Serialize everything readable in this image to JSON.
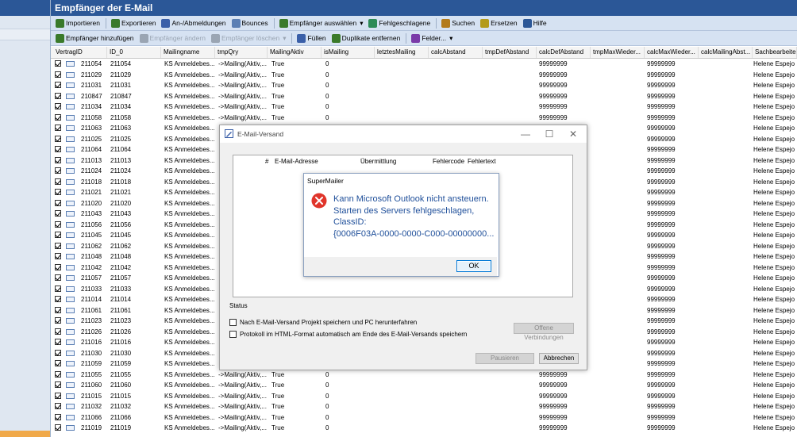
{
  "window": {
    "title": "Empfänger der E-Mail"
  },
  "toolbar1": [
    {
      "label": "Importieren",
      "icon": "import-icon",
      "color": "#3a7a2a"
    },
    {
      "label": "Exportieren",
      "icon": "export-icon",
      "color": "#3a7a2a"
    },
    {
      "label": "An-/Abmeldungen",
      "icon": "users-icon",
      "color": "#3a5fa8"
    },
    {
      "label": "Bounces",
      "icon": "bounce-icon",
      "color": "#5b7fb4"
    },
    {
      "label": "Empfänger auswählen",
      "icon": "checkbox-icon",
      "color": "#3a7a2a",
      "dropdown": "▾"
    },
    {
      "label": "Fehlgeschlagene",
      "icon": "failed-icon",
      "color": "#2e8b57"
    },
    {
      "label": "Suchen",
      "icon": "binoculars-icon",
      "color": "#b37a1a"
    },
    {
      "label": "Ersetzen",
      "icon": "replace-icon",
      "color": "#b39a1a"
    },
    {
      "label": "Hilfe",
      "icon": "help-icon",
      "color": "#2b5797"
    }
  ],
  "toolbar2": [
    {
      "label": "Empfänger hinzufügen",
      "icon": "add-recipient-icon",
      "color": "#3a7a2a",
      "disabled": false
    },
    {
      "label": "Empfänger ändern",
      "icon": "edit-recipient-icon",
      "color": "#9aa5b3",
      "disabled": true
    },
    {
      "label": "Empfänger löschen",
      "icon": "delete-recipient-icon",
      "color": "#9aa5b3",
      "disabled": true,
      "dropdown": "▾"
    },
    {
      "label": "Füllen",
      "icon": "fill-icon",
      "color": "#3a5fa8",
      "disabled": false
    },
    {
      "label": "Duplikate entfernen",
      "icon": "duplicates-icon",
      "color": "#3a7a2a",
      "disabled": false
    },
    {
      "label": "Felder...",
      "icon": "fields-icon",
      "color": "#7a3aa8",
      "disabled": false,
      "dropdown": "▾"
    }
  ],
  "grid": {
    "columns": [
      "VertragID",
      "ID_0",
      "Mailingname",
      "tmpQry",
      "MailingAktiv",
      "isMailing",
      "letztesMailing",
      "calcAbstand",
      "tmpDefAbstand",
      "calcDefAbstand",
      "tmpMaxWieder...",
      "calcMaxWieder...",
      "calcMailingAbst...",
      "Sachbearbeiter"
    ],
    "rows": [
      {
        "id": "211054",
        "id0": "211054",
        "mailing": "KS Anmeldebes...",
        "qry": "->Mailing(Aktiv,...",
        "aktiv": "True",
        "is": "0",
        "def": "99999999",
        "max": "99999999",
        "sb": "Helene Espejo"
      },
      {
        "id": "211029",
        "id0": "211029",
        "mailing": "KS Anmeldebes...",
        "qry": "->Mailing(Aktiv,...",
        "aktiv": "True",
        "is": "0",
        "def": "99999999",
        "max": "99999999",
        "sb": "Helene Espejo"
      },
      {
        "id": "211031",
        "id0": "211031",
        "mailing": "KS Anmeldebes...",
        "qry": "->Mailing(Aktiv,...",
        "aktiv": "True",
        "is": "0",
        "def": "99999999",
        "max": "99999999",
        "sb": "Helene Espejo"
      },
      {
        "id": "210847",
        "id0": "210847",
        "mailing": "KS Anmeldebes...",
        "qry": "->Mailing(Aktiv,...",
        "aktiv": "True",
        "is": "0",
        "def": "99999999",
        "max": "99999999",
        "sb": "Helene Espejo"
      },
      {
        "id": "211034",
        "id0": "211034",
        "mailing": "KS Anmeldebes...",
        "qry": "->Mailing(Aktiv,...",
        "aktiv": "True",
        "is": "0",
        "def": "99999999",
        "max": "99999999",
        "sb": "Helene Espejo"
      },
      {
        "id": "211058",
        "id0": "211058",
        "mailing": "KS Anmeldebes...",
        "qry": "->Mailing(Aktiv,...",
        "aktiv": "True",
        "is": "0",
        "def": "99999999",
        "max": "99999999",
        "sb": "Helene Espejo"
      },
      {
        "id": "211063",
        "id0": "211063",
        "mailing": "KS Anmeldebes...",
        "qry": "",
        "aktiv": "",
        "is": "",
        "def": "",
        "max": "99999999",
        "sb": "Helene Espejo"
      },
      {
        "id": "211025",
        "id0": "211025",
        "mailing": "KS Anmeldebes...",
        "qry": "",
        "aktiv": "",
        "is": "",
        "def": "",
        "max": "99999999",
        "sb": "Helene Espejo"
      },
      {
        "id": "211064",
        "id0": "211064",
        "mailing": "KS Anmeldebes...",
        "qry": "",
        "aktiv": "",
        "is": "",
        "def": "",
        "max": "99999999",
        "sb": "Helene Espejo"
      },
      {
        "id": "211013",
        "id0": "211013",
        "mailing": "KS Anmeldebes...",
        "qry": "",
        "aktiv": "",
        "is": "",
        "def": "",
        "max": "99999999",
        "sb": "Helene Espejo"
      },
      {
        "id": "211024",
        "id0": "211024",
        "mailing": "KS Anmeldebes...",
        "qry": "",
        "aktiv": "",
        "is": "",
        "def": "",
        "max": "99999999",
        "sb": "Helene Espejo"
      },
      {
        "id": "211018",
        "id0": "211018",
        "mailing": "KS Anmeldebes...",
        "qry": "",
        "aktiv": "",
        "is": "",
        "def": "",
        "max": "99999999",
        "sb": "Helene Espejo"
      },
      {
        "id": "211021",
        "id0": "211021",
        "mailing": "KS Anmeldebes...",
        "qry": "",
        "aktiv": "",
        "is": "",
        "def": "",
        "max": "99999999",
        "sb": "Helene Espejo"
      },
      {
        "id": "211020",
        "id0": "211020",
        "mailing": "KS Anmeldebes...",
        "qry": "",
        "aktiv": "",
        "is": "",
        "def": "",
        "max": "99999999",
        "sb": "Helene Espejo"
      },
      {
        "id": "211043",
        "id0": "211043",
        "mailing": "KS Anmeldebes...",
        "qry": "",
        "aktiv": "",
        "is": "",
        "def": "",
        "max": "99999999",
        "sb": "Helene Espejo"
      },
      {
        "id": "211056",
        "id0": "211056",
        "mailing": "KS Anmeldebes...",
        "qry": "",
        "aktiv": "",
        "is": "",
        "def": "",
        "max": "99999999",
        "sb": "Helene Espejo"
      },
      {
        "id": "211045",
        "id0": "211045",
        "mailing": "KS Anmeldebes...",
        "qry": "",
        "aktiv": "",
        "is": "",
        "def": "",
        "max": "99999999",
        "sb": "Helene Espejo"
      },
      {
        "id": "211062",
        "id0": "211062",
        "mailing": "KS Anmeldebes...",
        "qry": "",
        "aktiv": "",
        "is": "",
        "def": "",
        "max": "99999999",
        "sb": "Helene Espejo"
      },
      {
        "id": "211048",
        "id0": "211048",
        "mailing": "KS Anmeldebes...",
        "qry": "",
        "aktiv": "",
        "is": "",
        "def": "",
        "max": "99999999",
        "sb": "Helene Espejo"
      },
      {
        "id": "211042",
        "id0": "211042",
        "mailing": "KS Anmeldebes...",
        "qry": "",
        "aktiv": "",
        "is": "",
        "def": "",
        "max": "99999999",
        "sb": "Helene Espejo"
      },
      {
        "id": "211057",
        "id0": "211057",
        "mailing": "KS Anmeldebes...",
        "qry": "",
        "aktiv": "",
        "is": "",
        "def": "",
        "max": "99999999",
        "sb": "Helene Espejo"
      },
      {
        "id": "211033",
        "id0": "211033",
        "mailing": "KS Anmeldebes...",
        "qry": "",
        "aktiv": "",
        "is": "",
        "def": "",
        "max": "99999999",
        "sb": "Helene Espejo"
      },
      {
        "id": "211014",
        "id0": "211014",
        "mailing": "KS Anmeldebes...",
        "qry": "",
        "aktiv": "",
        "is": "",
        "def": "",
        "max": "99999999",
        "sb": "Helene Espejo"
      },
      {
        "id": "211061",
        "id0": "211061",
        "mailing": "KS Anmeldebes...",
        "qry": "",
        "aktiv": "",
        "is": "",
        "def": "",
        "max": "99999999",
        "sb": "Helene Espejo"
      },
      {
        "id": "211023",
        "id0": "211023",
        "mailing": "KS Anmeldebes...",
        "qry": "",
        "aktiv": "",
        "is": "",
        "def": "",
        "max": "99999999",
        "sb": "Helene Espejo"
      },
      {
        "id": "211026",
        "id0": "211026",
        "mailing": "KS Anmeldebes...",
        "qry": "",
        "aktiv": "",
        "is": "",
        "def": "",
        "max": "99999999",
        "sb": "Helene Espejo"
      },
      {
        "id": "211016",
        "id0": "211016",
        "mailing": "KS Anmeldebes...",
        "qry": "",
        "aktiv": "",
        "is": "",
        "def": "",
        "max": "99999999",
        "sb": "Helene Espejo"
      },
      {
        "id": "211030",
        "id0": "211030",
        "mailing": "KS Anmeldebes...",
        "qry": "",
        "aktiv": "",
        "is": "",
        "def": "",
        "max": "99999999",
        "sb": "Helene Espejo"
      },
      {
        "id": "211059",
        "id0": "211059",
        "mailing": "KS Anmeldebes...",
        "qry": "",
        "aktiv": "",
        "is": "",
        "def": "",
        "max": "99999999",
        "sb": "Helene Espejo"
      },
      {
        "id": "211055",
        "id0": "211055",
        "mailing": "KS Anmeldebes...",
        "qry": "->Mailing(Aktiv,...",
        "aktiv": "True",
        "is": "0",
        "def": "99999999",
        "max": "99999999",
        "sb": "Helene Espejo"
      },
      {
        "id": "211060",
        "id0": "211060",
        "mailing": "KS Anmeldebes...",
        "qry": "->Mailing(Aktiv,...",
        "aktiv": "True",
        "is": "0",
        "def": "99999999",
        "max": "99999999",
        "sb": "Helene Espejo"
      },
      {
        "id": "211015",
        "id0": "211015",
        "mailing": "KS Anmeldebes...",
        "qry": "->Mailing(Aktiv,...",
        "aktiv": "True",
        "is": "0",
        "def": "99999999",
        "max": "99999999",
        "sb": "Helene Espejo"
      },
      {
        "id": "211032",
        "id0": "211032",
        "mailing": "KS Anmeldebes...",
        "qry": "->Mailing(Aktiv,...",
        "aktiv": "True",
        "is": "0",
        "def": "99999999",
        "max": "99999999",
        "sb": "Helene Espejo"
      },
      {
        "id": "211066",
        "id0": "211066",
        "mailing": "KS Anmeldebes...",
        "qry": "->Mailing(Aktiv,...",
        "aktiv": "True",
        "is": "0",
        "def": "99999999",
        "max": "99999999",
        "sb": "Helene Espejo"
      },
      {
        "id": "211019",
        "id0": "211019",
        "mailing": "KS Anmeldebes...",
        "qry": "->Mailing(Aktiv,...",
        "aktiv": "True",
        "is": "0",
        "def": "99999999",
        "max": "99999999",
        "sb": "Helene Espejo"
      }
    ]
  },
  "versand_dialog": {
    "title": "E-Mail-Versand",
    "controls": {
      "minimize": "—",
      "maximize": "☐",
      "close": "✕"
    },
    "list_columns": [
      "#",
      "E-Mail-Adresse",
      "Übermittlung",
      "Fehlercode",
      "Fehlertext"
    ],
    "status_label": "Status",
    "option_shutdown": "Nach E-Mail-Versand Projekt speichern und PC herunterfahren",
    "option_protocol": "Protokoll im HTML-Format automatisch am Ende des E-Mail-Versands speichern",
    "open_connections": "Offene Verbindungen",
    "pause": "Pausieren",
    "cancel": "Abbrechen"
  },
  "message_box": {
    "title": "SuperMailer",
    "icon": "error-icon",
    "lines": [
      "Kann Microsoft Outlook nicht ansteuern.",
      "Starten des Servers fehlgeschlagen,",
      "ClassID:",
      "{0006F03A-0000-0000-C000-00000000..."
    ],
    "ok": "OK"
  },
  "colors": {
    "title_bar": "#2b5797",
    "toolbar": "#d6e2f2",
    "message_text": "#1f4f9a",
    "error_red": "#e0352b"
  }
}
